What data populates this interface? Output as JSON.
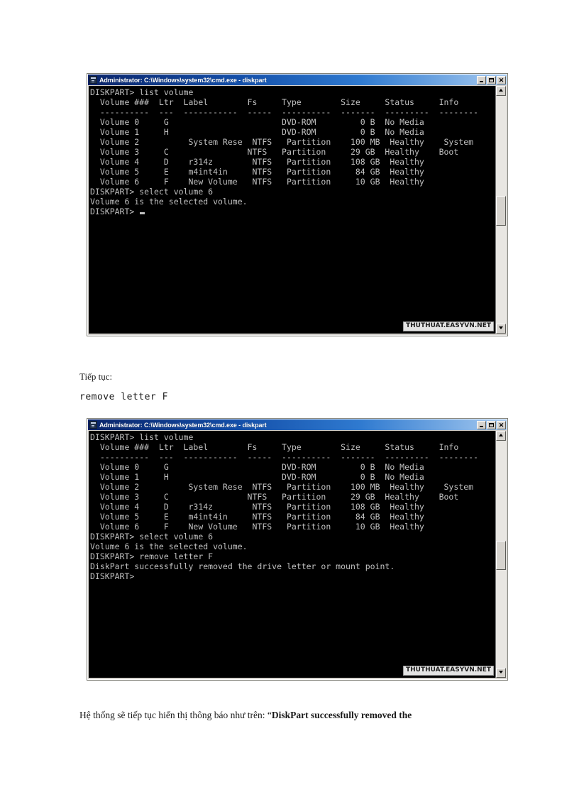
{
  "document": {
    "paragraph_between": "Tiếp tục:",
    "command_line": "remove letter F",
    "paragraph_bottom_plain": "Hệ thống sẽ tiếp tục hiển thị thông báo như trên: “",
    "paragraph_bottom_bold": "DiskPart successfully removed the"
  },
  "window1": {
    "title": "Administrator: C:\\Windows\\system32\\cmd.exe - diskpart",
    "icon": "cmd-icon",
    "buttons": {
      "minimize": "minimize",
      "maximize": "maximize",
      "close": "✕"
    },
    "watermark": "THUTHUAT.EASYVN.NET",
    "lines": [
      "DISKPART> list volume",
      "",
      "  Volume ###  Ltr  Label        Fs     Type        Size     Status     Info",
      "  ----------  ---  -----------  -----  ----------  -------  ---------  --------",
      "  Volume 0     G                       DVD-ROM         0 B  No Media",
      "  Volume 1     H                       DVD-ROM         0 B  No Media",
      "  Volume 2          System Rese  NTFS   Partition    100 MB  Healthy    System",
      "  Volume 3     C                NTFS   Partition     29 GB  Healthy    Boot",
      "  Volume 4     D    r314z        NTFS   Partition    108 GB  Healthy",
      "  Volume 5     E    m4int4in     NTFS   Partition     84 GB  Healthy",
      "  Volume 6     F    New Volume   NTFS   Partition     10 GB  Healthy",
      "",
      "DISKPART> select volume 6",
      "",
      "Volume 6 is the selected volume.",
      "",
      "DISKPART> "
    ]
  },
  "window2": {
    "title": "Administrator: C:\\Windows\\system32\\cmd.exe - diskpart",
    "icon": "cmd-icon",
    "buttons": {
      "minimize": "minimize",
      "maximize": "maximize",
      "close": "✕"
    },
    "watermark": "THUTHUAT.EASYVN.NET",
    "lines": [
      "DISKPART> list volume",
      "",
      "  Volume ###  Ltr  Label        Fs     Type        Size     Status     Info",
      "  ----------  ---  -----------  -----  ----------  -------  ---------  --------",
      "  Volume 0     G                       DVD-ROM         0 B  No Media",
      "  Volume 1     H                       DVD-ROM         0 B  No Media",
      "  Volume 2          System Rese  NTFS   Partition    100 MB  Healthy    System",
      "  Volume 3     C                NTFS   Partition     29 GB  Healthy    Boot",
      "  Volume 4     D    r314z        NTFS   Partition    108 GB  Healthy",
      "  Volume 5     E    m4int4in     NTFS   Partition     84 GB  Healthy",
      "  Volume 6     F    New Volume   NTFS   Partition     10 GB  Healthy",
      "",
      "DISKPART> select volume 6",
      "",
      "Volume 6 is the selected volume.",
      "",
      "DISKPART> remove letter F",
      "",
      "DiskPart successfully removed the drive letter or mount point.",
      "",
      "DISKPART>"
    ]
  }
}
